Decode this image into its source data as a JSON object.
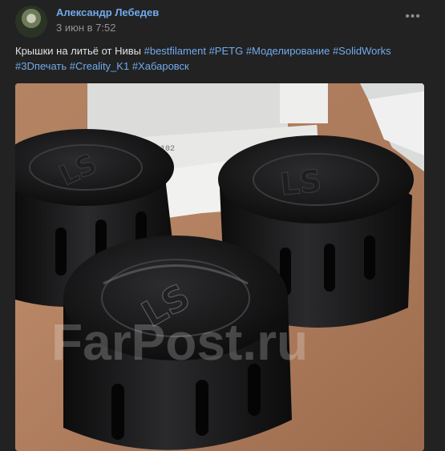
{
  "post": {
    "author": "Александр Лебедев",
    "date": "3 июн в 7:52",
    "more_icon": "more-horizontal-icon",
    "text": "Крышки на литьё от Нивы",
    "tags": [
      "#bestfilament",
      "#PETG",
      "#Моделирование",
      "#SolidWorks",
      "#3Dпечать",
      "#Creality_K1",
      "#Хабаровск"
    ]
  },
  "photo": {
    "cap_logo_text": "LS",
    "watermark": "FarPost.ru",
    "paper_print": "0 ЗАЕ 102",
    "colors": {
      "table": "#b7825e",
      "cap": "#161617",
      "paper": "#e6e6e4"
    }
  }
}
